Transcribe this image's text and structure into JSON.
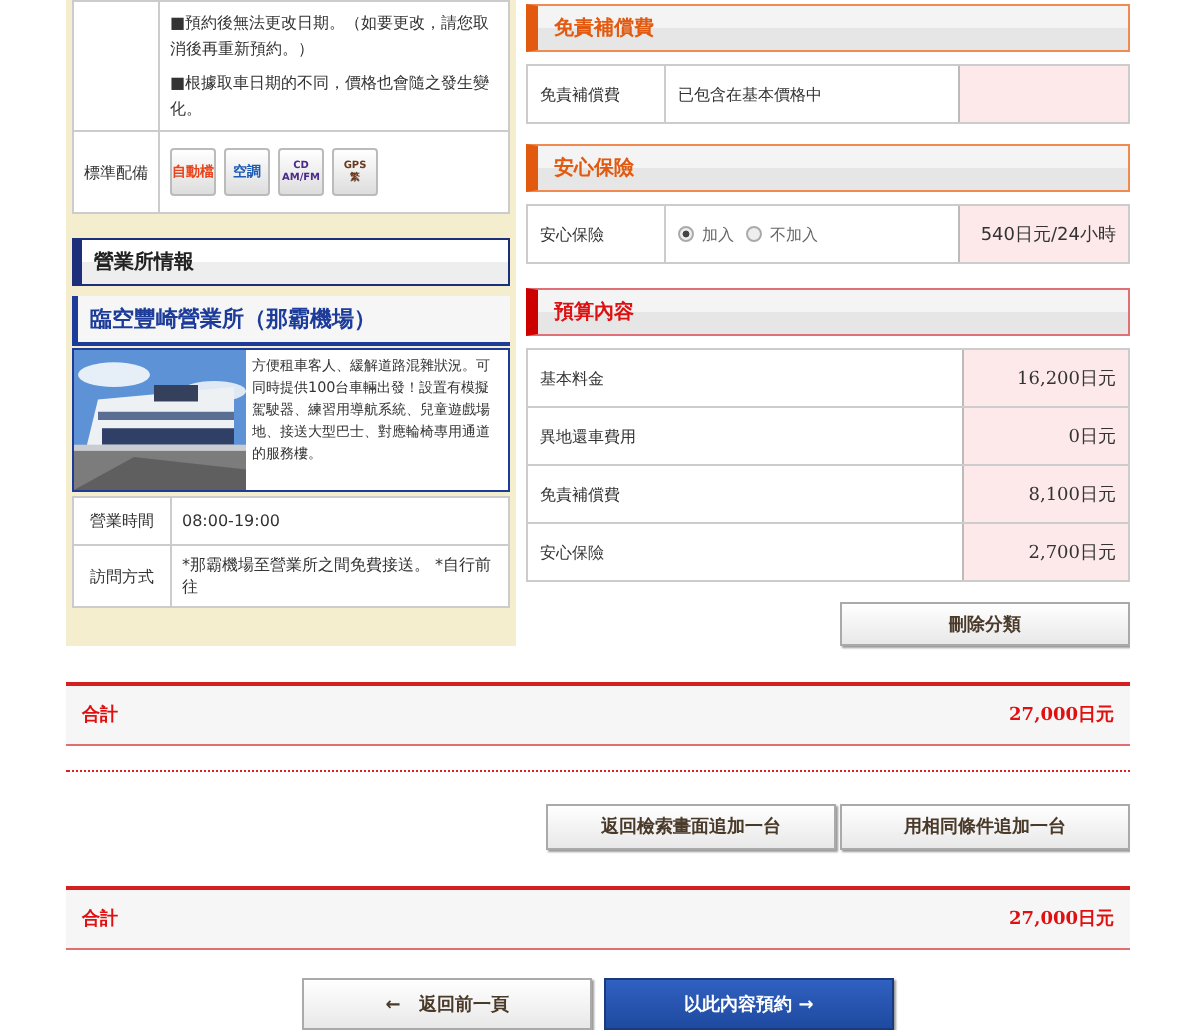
{
  "notes": [
    "■預約後無法更改日期。（如要更改，請您取消後再重新預約。）",
    "■根據取車日期的不同，價格也會隨之發生變化。"
  ],
  "equipment": {
    "label": "標準配備",
    "badges": [
      {
        "lines": [
          "自動檔"
        ],
        "color": "#e8431a"
      },
      {
        "lines": [
          "空調"
        ],
        "color": "#1f5bb5"
      },
      {
        "lines": [
          "CD",
          "AM/FM"
        ],
        "color": "#4a2a8a"
      },
      {
        "lines": [
          "GPS",
          "繁"
        ],
        "color": "#6b3a1e"
      }
    ]
  },
  "office": {
    "section_title": "營業所情報",
    "name": "臨空豐崎營業所（那霸機場）",
    "description": "方便租車客人、緩解道路混雜狀況。可同時提供100台車輛出發！設置有模擬駕駛器、練習用導航系統、兒童遊戲場地、接送大型巴士、對應輪椅專用通道的服務樓。",
    "rows": [
      {
        "label": "營業時間",
        "value": "08:00-19:00"
      },
      {
        "label": "訪問方式",
        "value": "*那霸機場至營業所之間免費接送。 *自行前往"
      }
    ]
  },
  "waiver": {
    "title": "免責補償費",
    "label": "免責補償費",
    "value": "已包含在基本價格中"
  },
  "insurance": {
    "title": "安心保險",
    "label": "安心保險",
    "options": [
      {
        "label": "加入",
        "selected": true
      },
      {
        "label": "不加入",
        "selected": false
      }
    ],
    "price": "540日元/24小時"
  },
  "budget": {
    "title": "預算內容",
    "rows": [
      {
        "label": "基本料金",
        "value": "16,200日元"
      },
      {
        "label": "異地還車費用",
        "value": "0日元"
      },
      {
        "label": "免責補償費",
        "value": "8,100日元"
      },
      {
        "label": "安心保險",
        "value": "2,700日元"
      }
    ],
    "delete_button": "刪除分類"
  },
  "total_top": {
    "label": "合計",
    "value": "27,000日元"
  },
  "add_buttons": [
    "返回檢索畫面追加一台",
    "用相同條件追加一台"
  ],
  "total_bottom": {
    "label": "合計",
    "value": "27,000日元"
  },
  "nav": {
    "back": {
      "arrow": "←",
      "label": "返回前一頁"
    },
    "confirm": {
      "label": "以此內容預約",
      "arrow": "→"
    }
  }
}
